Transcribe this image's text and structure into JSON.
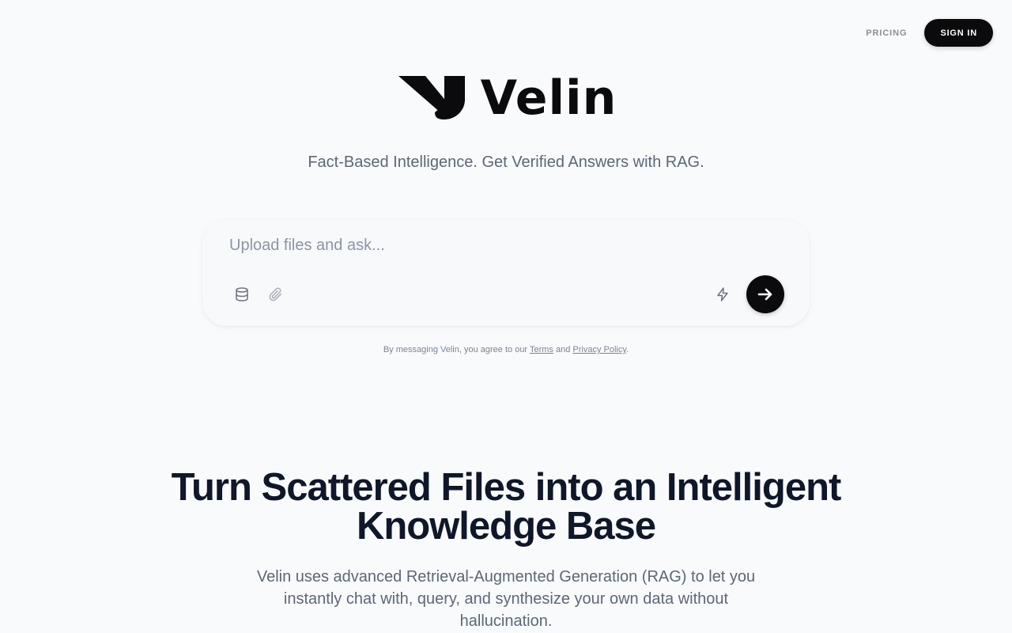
{
  "nav": {
    "pricing_label": "PRICING",
    "signin_label": "SIGN IN"
  },
  "brand": {
    "name": "Velin",
    "tagline": "Fact-Based Intelligence. Get Verified Answers with RAG."
  },
  "chat": {
    "placeholder": "Upload files and ask...",
    "value": "",
    "icons": {
      "knowledge_base": "database-icon",
      "attach": "paperclip-icon",
      "mode": "lightning-bolt-icon",
      "send": "arrow-right-icon"
    }
  },
  "terms": {
    "prefix": "By messaging Velin, you agree to our",
    "terms_link": "Terms",
    "conjunction": "and",
    "privacy_link": "Privacy Policy",
    "suffix": "."
  },
  "hero": {
    "headline_line1": "Turn Scattered Files into an Intelligent",
    "headline_line2": "Knowledge Base",
    "description": "Velin uses advanced Retrieval-Augmented Generation (RAG) to let you instantly chat with, query, and synthesize your own data without hallucination."
  },
  "colors": {
    "background": "#f9fafb",
    "primary_dark": "#0b0b0d",
    "muted_text": "#5d6778",
    "headline": "#0f172a"
  }
}
